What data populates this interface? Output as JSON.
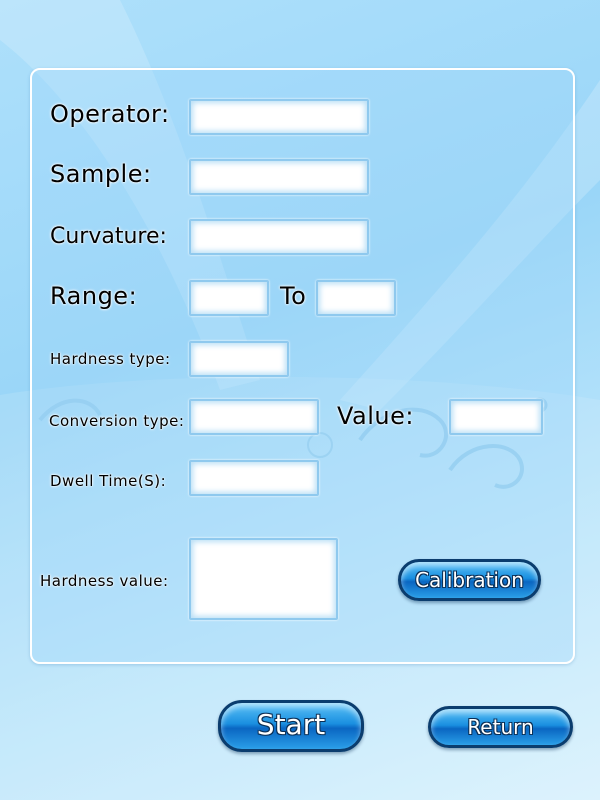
{
  "form": {
    "operator_label": "Operator:",
    "sample_label": "Sample:",
    "curvature_label": "Curvature:",
    "range_label": "Range:",
    "range_to_label": "To",
    "hardness_type_label": "Hardness type:",
    "conversion_type_label": "Conversion type:",
    "value_label": "Value:",
    "dwell_time_label": "Dwell Time(S):",
    "hardness_value_label": "Hardness value:",
    "operator_value": "",
    "sample_value": "",
    "curvature_value": "",
    "range_from_value": "",
    "range_to_value": "",
    "hardness_type_value": "",
    "conversion_type_value": "",
    "value_value": "",
    "dwell_time_value": "",
    "hardness_value_value": ""
  },
  "buttons": {
    "calibration": "Calibration",
    "start": "Start",
    "return": "Return"
  },
  "colors": {
    "background": "#9ad6f8",
    "button_blue": "#1a8fe0",
    "button_border": "#0b3d6e",
    "field_border": "#8fc9ee"
  }
}
